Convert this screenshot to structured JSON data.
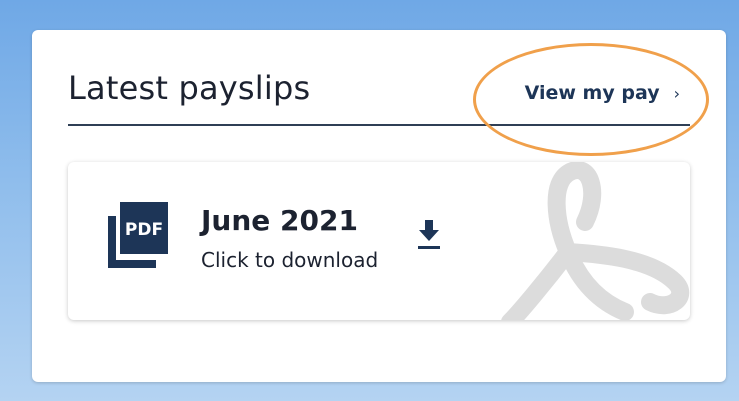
{
  "payslips_panel": {
    "title": "Latest payslips",
    "view_link_label": "View my pay",
    "view_link_chevron": "›"
  },
  "payslip_card": {
    "icon_label": "PDF",
    "month": "June 2021",
    "action_text": "Click to download"
  },
  "colors": {
    "brand_navy": "#1d3557",
    "annotation_orange": "#f0a04b"
  }
}
